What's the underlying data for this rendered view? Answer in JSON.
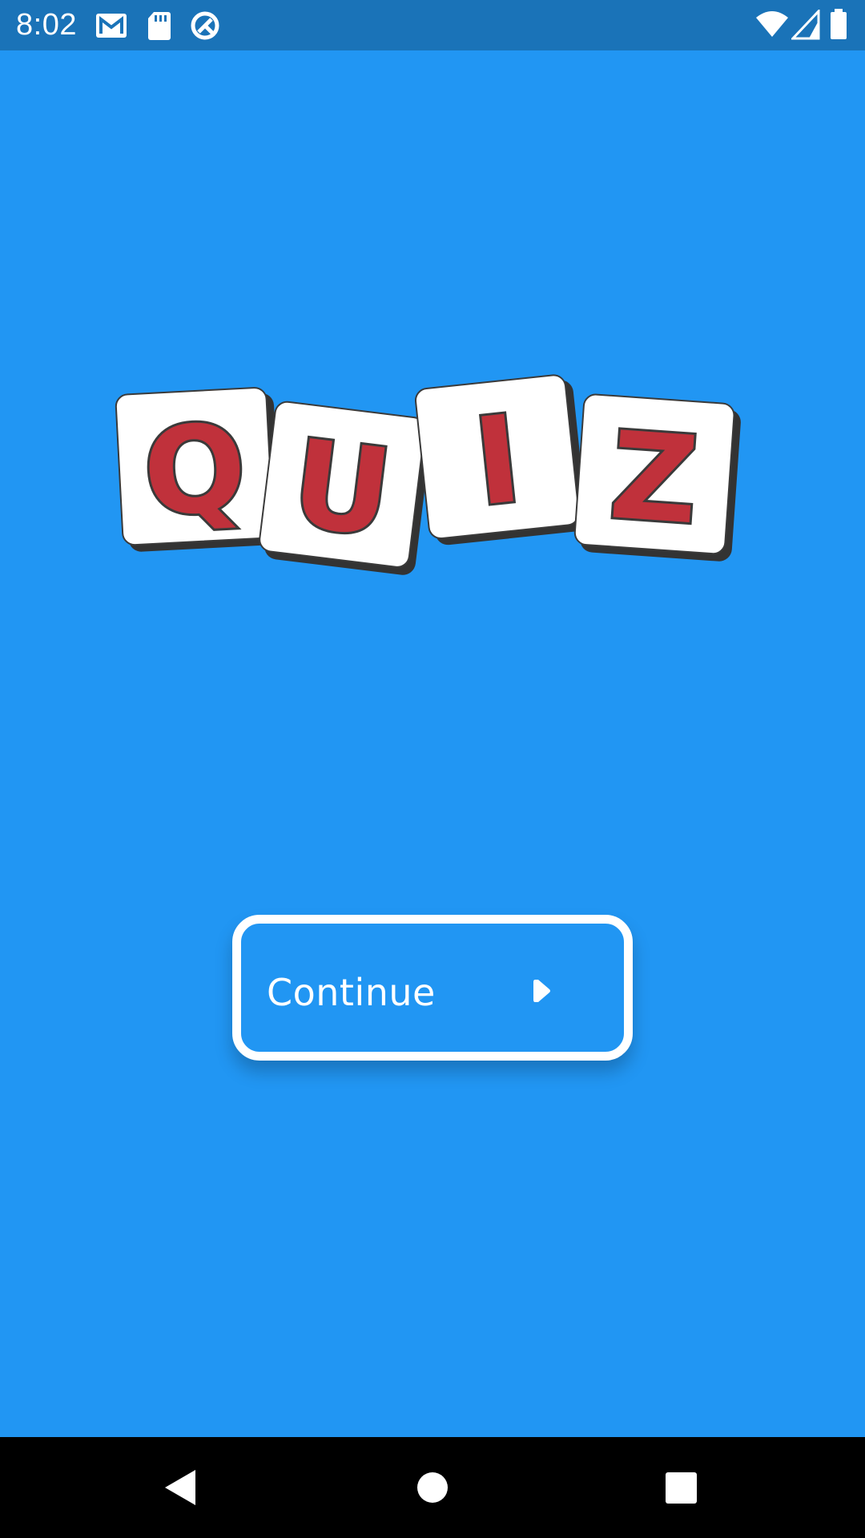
{
  "status_bar": {
    "time": "8:02",
    "left_icons": [
      "gmail-icon",
      "sd-card-icon",
      "sync-icon"
    ],
    "right_icons": [
      "wifi-icon",
      "signal-icon",
      "battery-icon"
    ]
  },
  "logo": {
    "letters": [
      "Q",
      "U",
      "I",
      "Z"
    ],
    "letter_color": "#c0313b",
    "tile_color": "#ffffff"
  },
  "continue_button": {
    "label": "Continue",
    "icon": "play-arrow-icon"
  },
  "navigation_bar": {
    "buttons": [
      "back-icon",
      "home-icon",
      "recents-icon"
    ]
  },
  "colors": {
    "background": "#2196f3",
    "status_bar": "#1a73b8",
    "nav_bar": "#000000",
    "button_border": "#ffffff"
  }
}
